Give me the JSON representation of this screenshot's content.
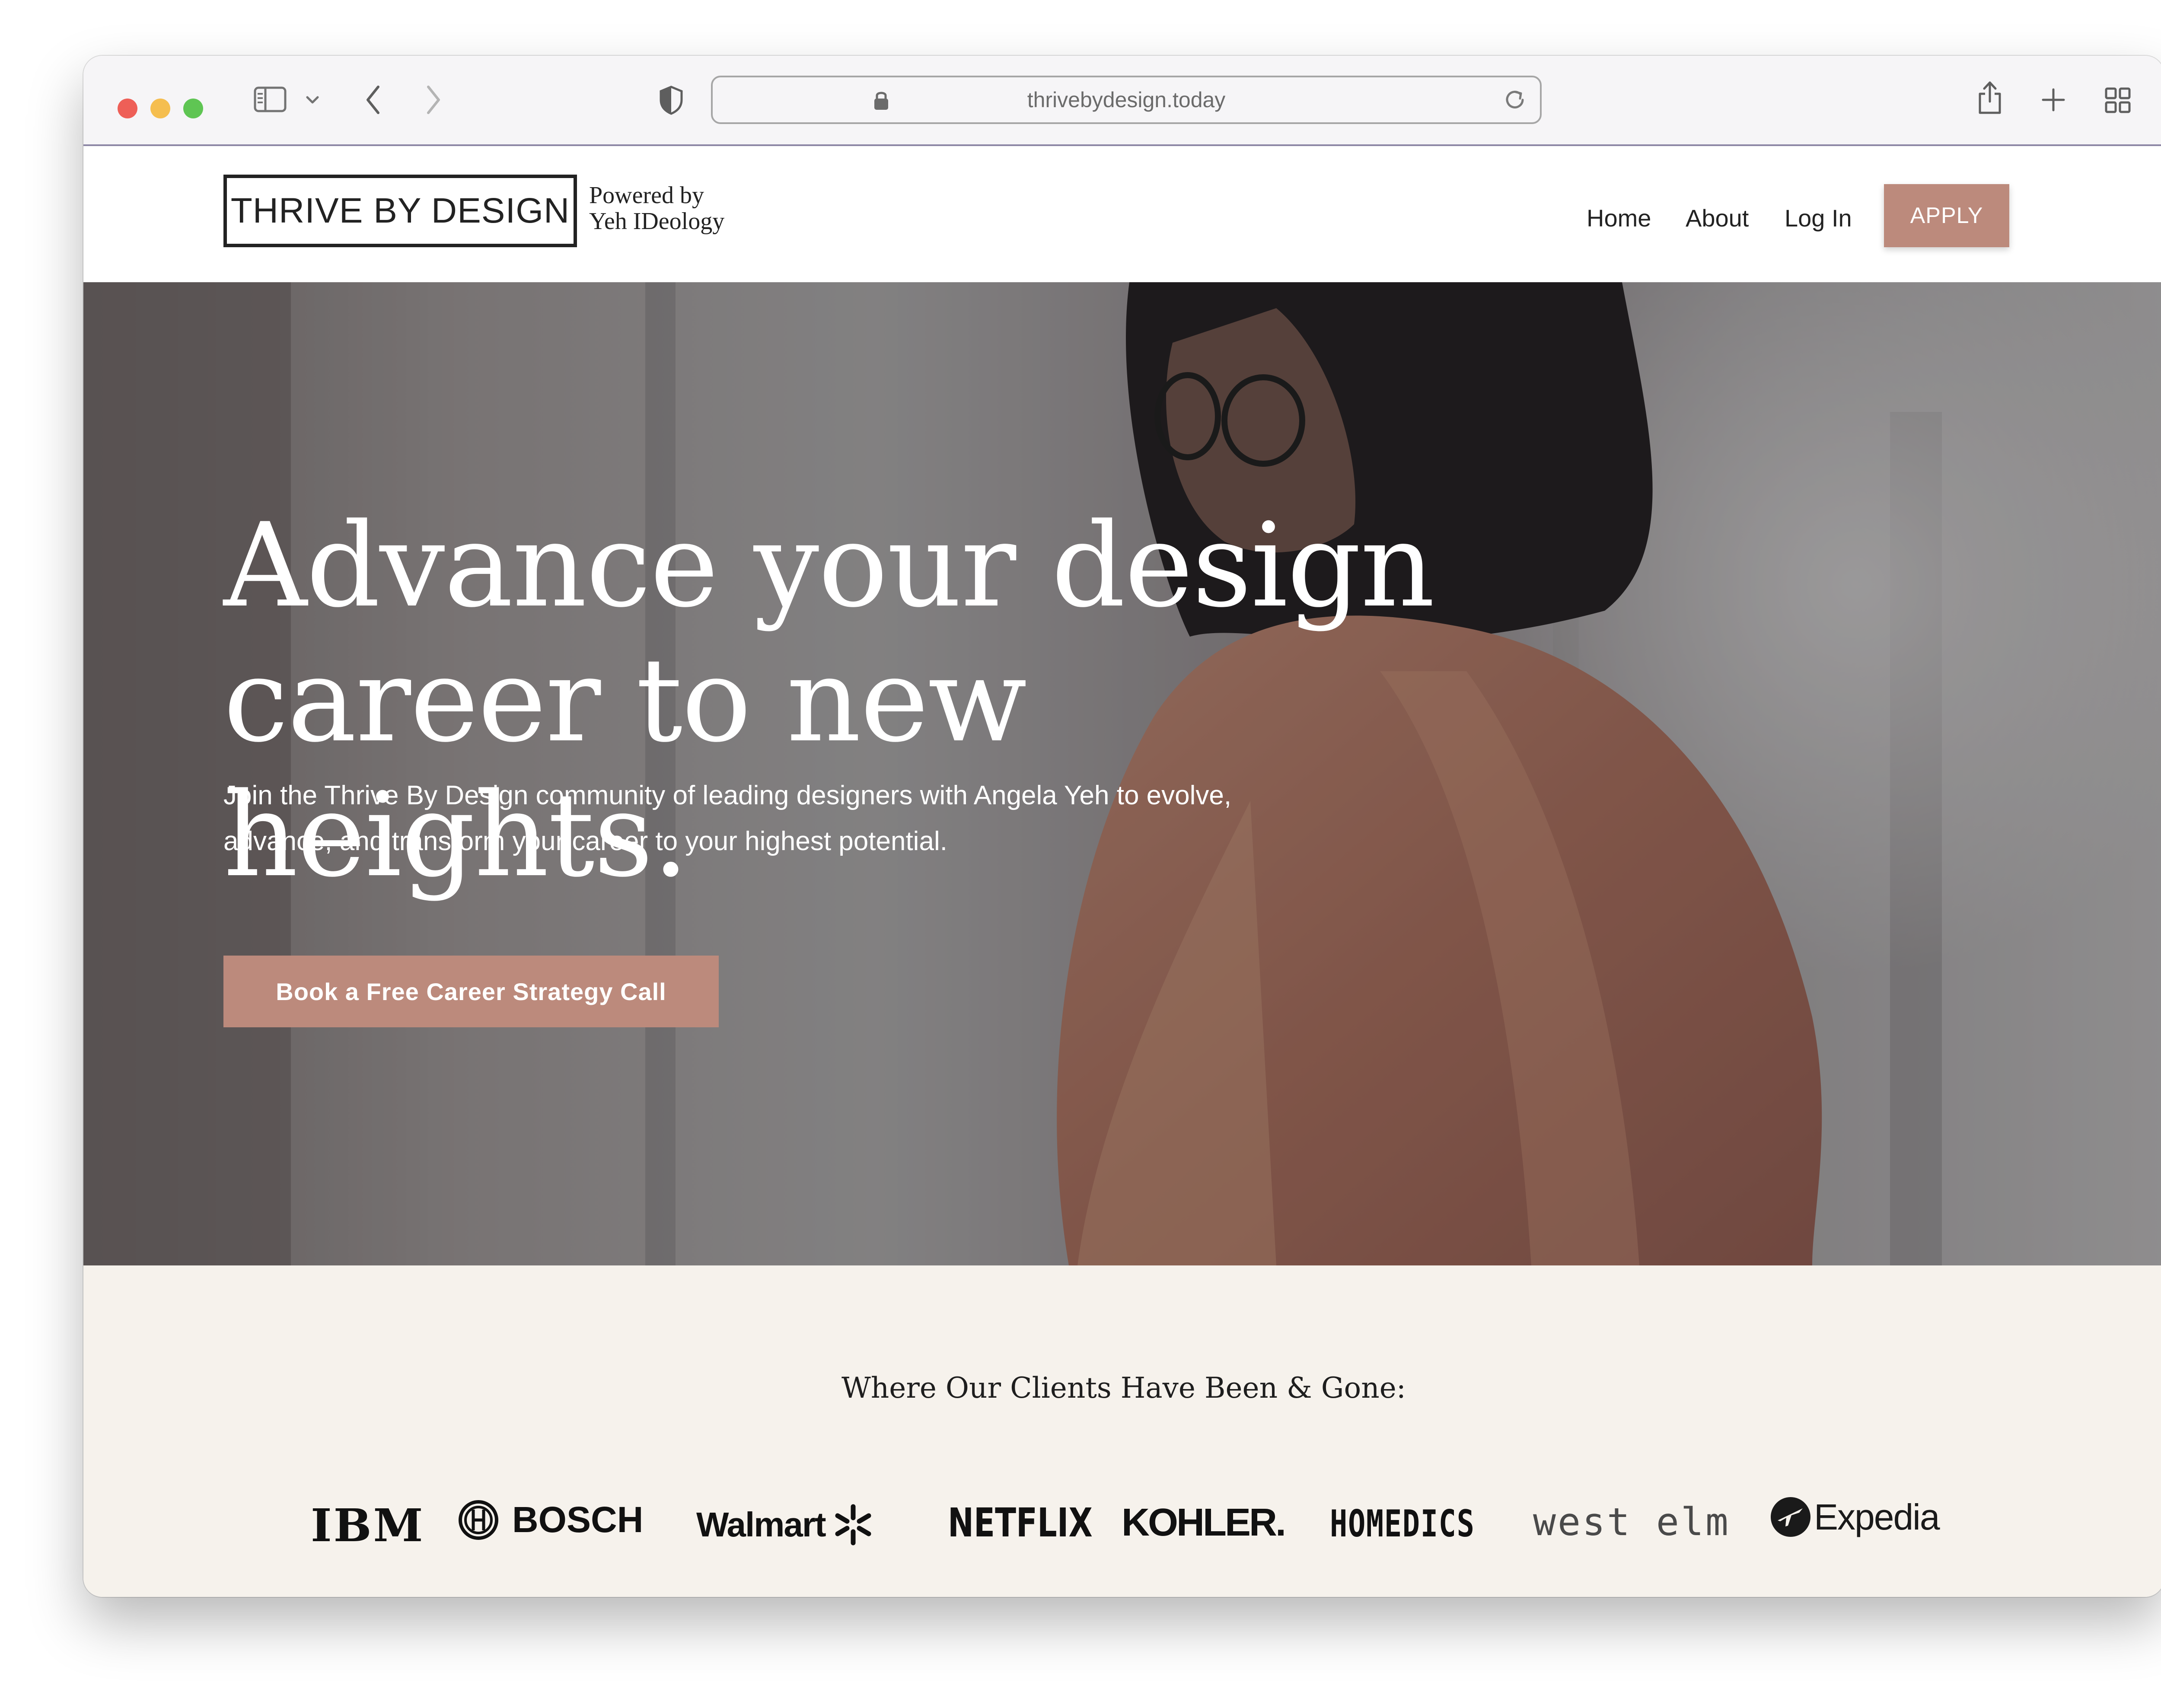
{
  "browser": {
    "url": "thrivebydesign.today",
    "icons": [
      "sidebar-icon",
      "chevron-down-icon",
      "back-arrow-icon",
      "forward-arrow-icon",
      "shield-icon",
      "lock-icon",
      "reload-icon",
      "share-icon",
      "plus-icon",
      "tab-overview-icon"
    ]
  },
  "header": {
    "logo": "THRIVE BY DESIGN",
    "powered_line1": "Powered by",
    "powered_line2": "Yeh IDeology",
    "nav": [
      "Home",
      "About",
      "Log In"
    ],
    "apply": "APPLY"
  },
  "hero": {
    "title_line1": "Advance your design",
    "title_line2": "career to new heights.",
    "subtitle_line1": "Join the Thrive By Design community of leading designers with Angela Yeh to evolve,",
    "subtitle_line2": "advance, and transform your career to your highest potential.",
    "cta": "Book a Free Career Strategy Call"
  },
  "clients": {
    "heading": "Where Our Clients Have Been & Gone:",
    "logos": [
      "IBM",
      "BOSCH",
      "Walmart",
      "NETFLIX",
      "KOHLER.",
      "HOMEDICS",
      "west elm",
      "Expedia"
    ]
  },
  "colors": {
    "accent": "#bc8a7c",
    "clients_bg": "#f6f2ec",
    "text_dark": "#222222"
  }
}
